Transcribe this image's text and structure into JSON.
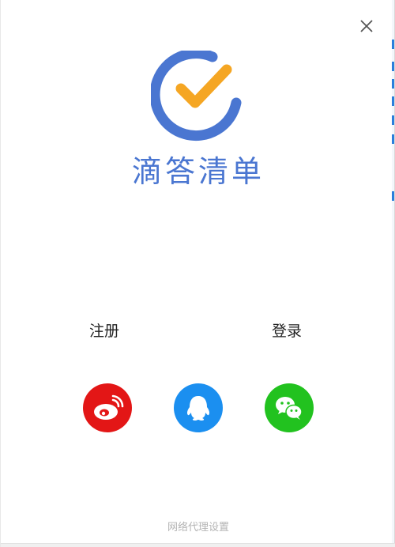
{
  "app": {
    "brand_name": "滴答清单",
    "accent_color": "#4a76d1",
    "check_color": "#f5a623"
  },
  "window_controls": {
    "close_icon": "close-icon"
  },
  "actions": {
    "register_label": "注册",
    "login_label": "登录"
  },
  "social_login": [
    {
      "name": "weibo",
      "icon": "weibo-icon",
      "color": "#e31616"
    },
    {
      "name": "qq",
      "icon": "qq-icon",
      "color": "#1b8ff0"
    },
    {
      "name": "wechat",
      "icon": "wechat-icon",
      "color": "#22c21f"
    }
  ],
  "footer": {
    "proxy_settings_label": "网络代理设置"
  }
}
